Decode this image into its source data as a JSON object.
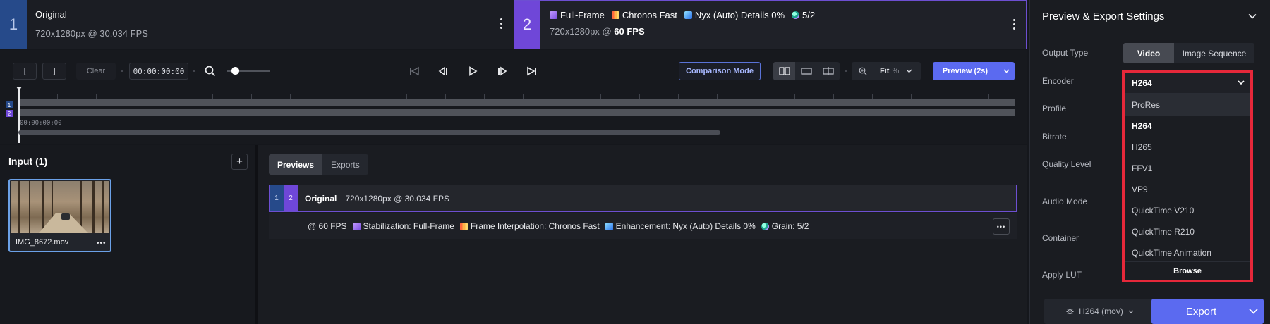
{
  "video_tabs": [
    {
      "number": "1",
      "title": "Original",
      "subtitle": "720x1280px @ 30.034 FPS"
    },
    {
      "number": "2",
      "chips": [
        "Full-Frame",
        "Chronos Fast",
        "Nyx (Auto) Details 0%",
        "5/2"
      ],
      "subtitle_prefix": "720x1280px @ ",
      "subtitle_bold": "60 FPS"
    }
  ],
  "toolbar": {
    "in_mark": "[",
    "out_mark": "]",
    "clear_label": "Clear",
    "timecode": "00:00:00:00",
    "comparison_label": "Comparison Mode",
    "fit_label": "Fit",
    "fit_unit": "%",
    "preview_label": "Preview (2s)"
  },
  "timeline": {
    "track_labels": [
      "1",
      "2"
    ],
    "time_label": "00:00:00:00"
  },
  "input_panel": {
    "title": "Input (1)",
    "file_name": "IMG_8672.mov",
    "more_label": "•••"
  },
  "list_panel": {
    "tabs": [
      "Previews",
      "Exports"
    ],
    "row_numbers": [
      "1",
      "2"
    ],
    "row_title": "Original",
    "row_info": "720x1280px @ 30.034 FPS",
    "row_fps": "@ 60 FPS",
    "row_details": [
      "Stabilization: Full-Frame",
      "Frame Interpolation: Chronos Fast",
      "Enhancement: Nyx (Auto) Details 0%",
      "Grain: 5/2"
    ],
    "more_label": "•••"
  },
  "settings": {
    "title": "Preview & Export Settings",
    "labels": [
      "Output Type",
      "Encoder",
      "Profile",
      "Bitrate",
      "Quality Level",
      "Audio Mode",
      "Container",
      "Apply LUT"
    ],
    "output_type_options": [
      "Video",
      "Image Sequence"
    ],
    "output_type_selected": "Video",
    "encoder_selected": "H264",
    "encoder_options": [
      "ProRes",
      "H264",
      "H265",
      "FFV1",
      "VP9",
      "QuickTime V210",
      "QuickTime R210",
      "QuickTime Animation"
    ],
    "encoder_browse": "Browse",
    "preset_label": "H264 (mov)",
    "export_label": "Export"
  },
  "colors": {
    "accent": "#5b6af0",
    "video1": "#264a8a",
    "video2": "#6f47d8",
    "highlight": "#e6283a"
  },
  "icons": [
    "kebab-icon",
    "search-icon",
    "skip-start-icon",
    "frame-back-icon",
    "play-icon",
    "frame-forward-icon",
    "skip-end-icon",
    "view-split-icon",
    "view-single-icon",
    "view-swipe-icon",
    "zoom-icon",
    "chevron-down-icon",
    "plus-icon",
    "gear-icon"
  ]
}
